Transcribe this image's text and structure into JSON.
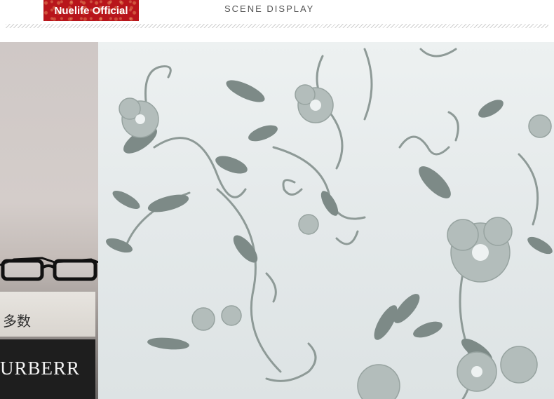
{
  "header": {
    "brand_badge": "Nuelife Official",
    "title": "SCENE DISPLAY"
  },
  "scene": {
    "book_brand_text": "URBERR",
    "book_spine_text": "多数",
    "icons": [
      "eyeglasses-icon",
      "floral-glass-pattern"
    ]
  },
  "colors": {
    "brand_badge_bg": "#b8151b",
    "glass_bg": "#e6ebec",
    "leaf_dark": "#7d8a87",
    "leaf_mid": "#9aa6a3",
    "flower": "#b3bdbb"
  }
}
